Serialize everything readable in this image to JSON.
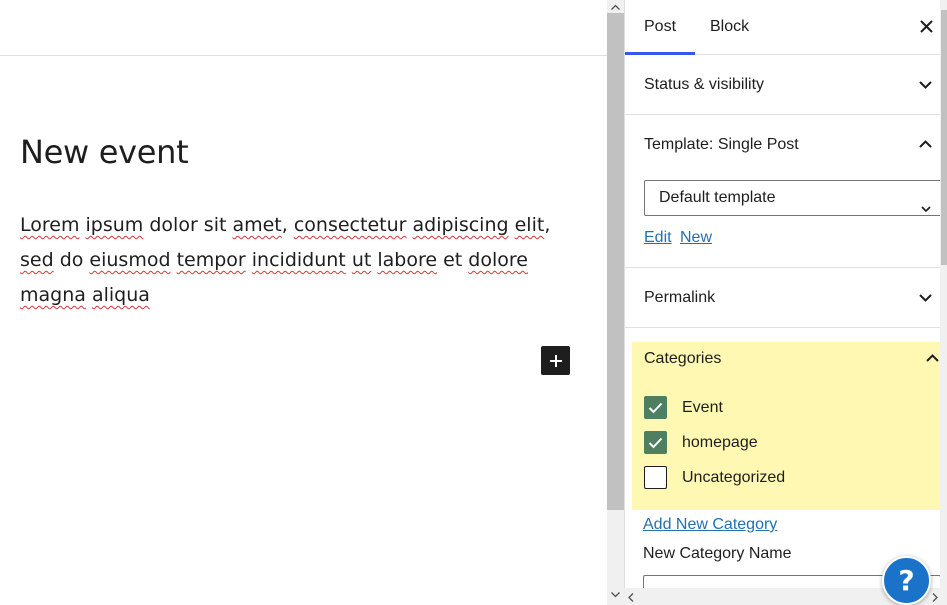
{
  "editor": {
    "title": "New event",
    "body_words": [
      {
        "t": "Lorem",
        "sp": true
      },
      {
        "t": " "
      },
      {
        "t": "ipsum",
        "sp": true
      },
      {
        "t": " dolor sit "
      },
      {
        "t": "amet",
        "sp": true
      },
      {
        "t": ", "
      },
      {
        "t": "consectetur",
        "sp": true
      },
      {
        "t": " "
      },
      {
        "t": "adipiscing",
        "sp": true
      },
      {
        "t": " "
      },
      {
        "t": "elit",
        "sp": true
      },
      {
        "t": ", "
      },
      {
        "t": "sed",
        "sp": true
      },
      {
        "t": " do "
      },
      {
        "t": "eiusmod",
        "sp": true
      },
      {
        "t": " "
      },
      {
        "t": "tempor",
        "sp": true
      },
      {
        "t": " "
      },
      {
        "t": "incididunt",
        "sp": true
      },
      {
        "t": " "
      },
      {
        "t": "ut",
        "sp": true
      },
      {
        "t": " "
      },
      {
        "t": "labore",
        "sp": true
      },
      {
        "t": " et "
      },
      {
        "t": "dolore",
        "sp": true
      },
      {
        "t": " "
      },
      {
        "t": "magna",
        "sp": true
      },
      {
        "t": " "
      },
      {
        "t": "aliqua",
        "sp": true
      }
    ],
    "add_block_icon": "plus-icon"
  },
  "sidebar": {
    "tabs": [
      {
        "label": "Post",
        "active": true
      },
      {
        "label": "Block",
        "active": false
      }
    ],
    "close_icon": "close-icon",
    "panels": {
      "status": {
        "label": "Status & visibility",
        "expanded": false
      },
      "template": {
        "label": "Template: Single Post",
        "expanded": true,
        "select_value": "Default template",
        "edit_link": "Edit",
        "new_link": "New"
      },
      "permalink": {
        "label": "Permalink",
        "expanded": false
      },
      "categories": {
        "label": "Categories",
        "expanded": true,
        "highlight_color": "#fef8b2",
        "items": [
          {
            "label": "Event",
            "checked": true
          },
          {
            "label": "homepage",
            "checked": true
          },
          {
            "label": "Uncategorized",
            "checked": false
          }
        ],
        "add_new_link": "Add New Category",
        "new_name_label": "New Category Name"
      }
    },
    "help_label": "?"
  },
  "colors": {
    "accent": "#3858e9",
    "link": "#2271b1",
    "checkbox": "#4d7f60",
    "help": "#1a73c8"
  }
}
